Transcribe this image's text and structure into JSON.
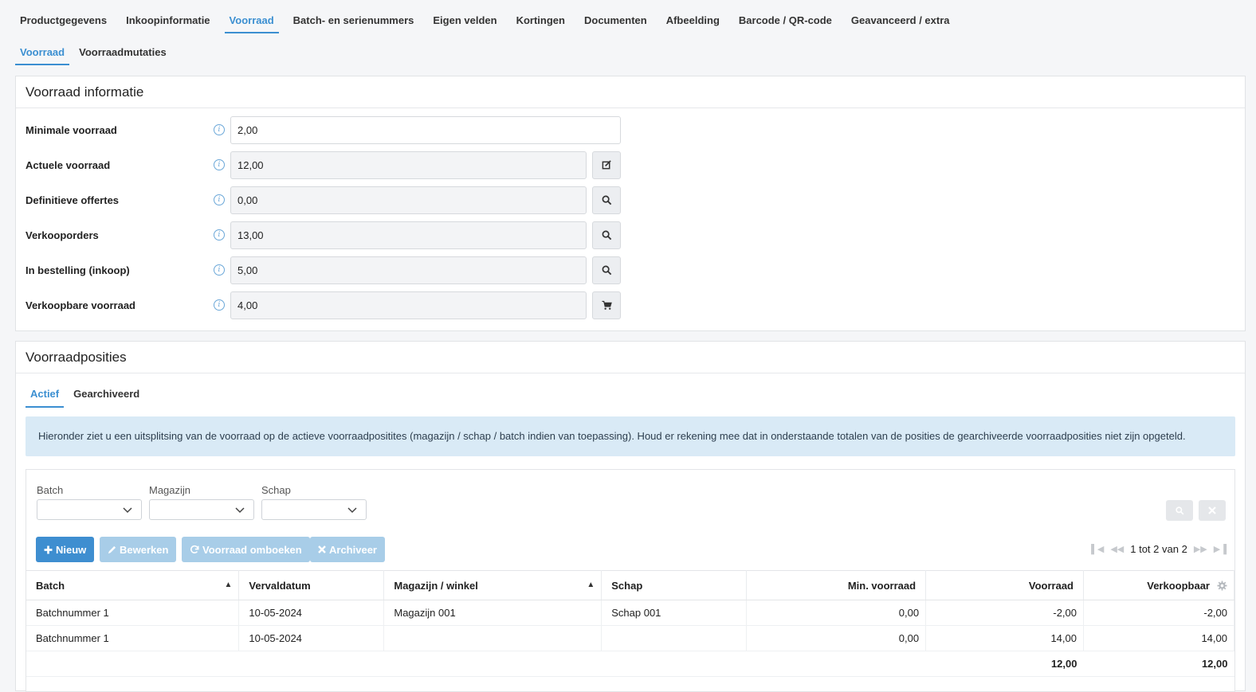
{
  "top_tabs": [
    "Productgegevens",
    "Inkoopinformatie",
    "Voorraad",
    "Batch- en serienummers",
    "Eigen velden",
    "Kortingen",
    "Documenten",
    "Afbeelding",
    "Barcode / QR-code",
    "Geavanceerd / extra"
  ],
  "sub_tabs": [
    "Voorraad",
    "Voorraadmutaties"
  ],
  "info_panel": {
    "title": "Voorraad informatie",
    "fields": [
      {
        "label": "Minimale voorraad",
        "value": "2,00"
      },
      {
        "label": "Actuele voorraad",
        "value": "12,00",
        "button_icon": "edit-icon"
      },
      {
        "label": "Definitieve offertes",
        "value": "0,00",
        "button_icon": "search-icon"
      },
      {
        "label": "Verkooporders",
        "value": "13,00",
        "button_icon": "search-icon"
      },
      {
        "label": "In bestelling (inkoop)",
        "value": "5,00",
        "button_icon": "search-icon"
      },
      {
        "label": "Verkoopbare voorraad",
        "value": "4,00",
        "button_icon": "cart-icon"
      }
    ]
  },
  "positions_panel": {
    "title": "Voorraadposities",
    "tabs": [
      "Actief",
      "Gearchiveerd"
    ],
    "notice": "Hieronder ziet u een uitsplitsing van de voorraad op de actieve voorraadpositites (magazijn / schap / batch indien van toepassing). Houd er rekening mee dat in onderstaande totalen van de posities de gearchiveerde voorraadposities niet zijn opgeteld.",
    "filters": [
      "Batch",
      "Magazijn",
      "Schap"
    ],
    "buttons": {
      "new": "Nieuw",
      "edit": "Bewerken",
      "rebook": "Voorraad omboeken",
      "archive": "Archiveer"
    },
    "pager": "1 tot 2 van 2",
    "columns": [
      "Batch",
      "Vervaldatum",
      "Magazijn / winkel",
      "Schap",
      "Min. voorraad",
      "Voorraad",
      "Verkoopbaar"
    ],
    "rows": [
      [
        "Batchnummer 1",
        "10-05-2024",
        "Magazijn 001",
        "Schap 001",
        "0,00",
        "-2,00",
        "-2,00"
      ],
      [
        "Batchnummer 1",
        "10-05-2024",
        "",
        "",
        "0,00",
        "14,00",
        "14,00"
      ]
    ],
    "totals": {
      "voorraad": "12,00",
      "verkoopbaar": "12,00"
    }
  },
  "colors": {
    "accent": "#3b8fd1",
    "primary_button": "#3e8ed0",
    "disabled_button": "#a8cde8",
    "notice_bg": "#d9eaf6"
  }
}
